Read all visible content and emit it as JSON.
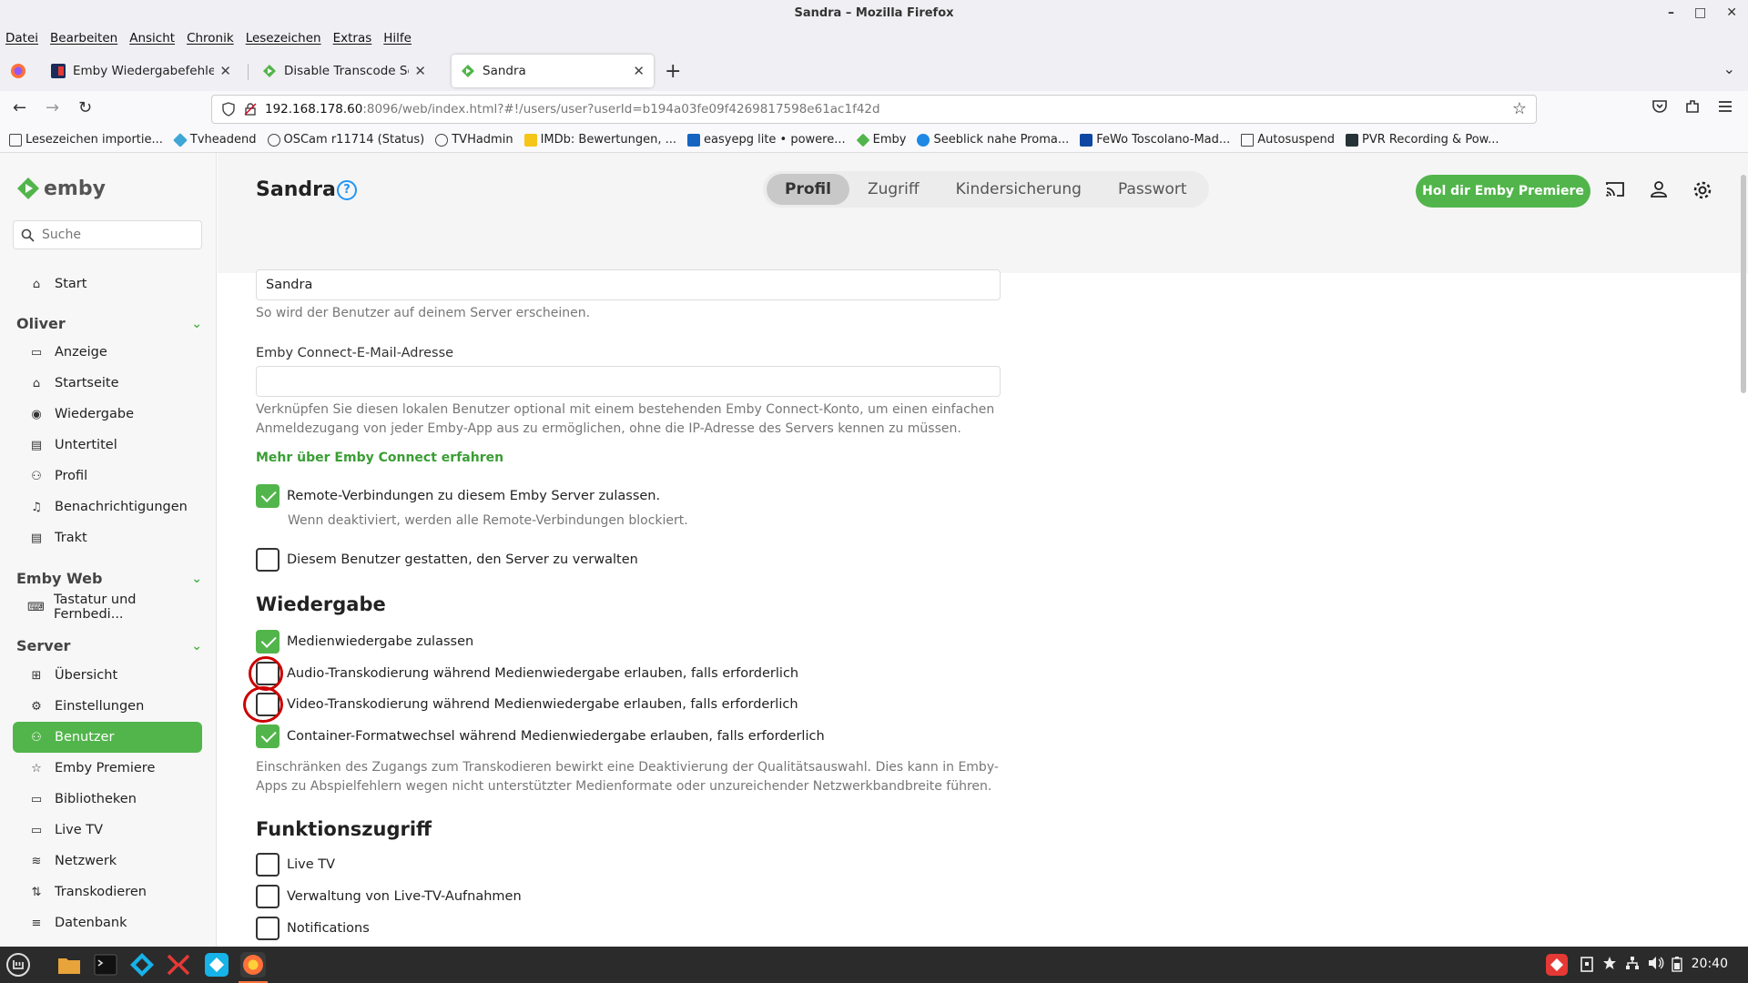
{
  "window": {
    "title": "Sandra – Mozilla Firefox",
    "minimize": "–",
    "maximize": "□",
    "close": "✕"
  },
  "menubar": [
    "Datei",
    "Bearbeiten",
    "Ansicht",
    "Chronik",
    "Lesezeichen",
    "Extras",
    "Hilfe"
  ],
  "tabs": [
    {
      "label": "Emby Wiedergabefehler be",
      "close": "✕"
    },
    {
      "label": "Disable Transcode Setting C",
      "close": "✕"
    },
    {
      "label": "Sandra",
      "close": "✕"
    }
  ],
  "newtab": "+",
  "tab_list": "⌄",
  "nav": {
    "back": "←",
    "forward": "→",
    "reload": "↻",
    "url_host": "192.168.178.60",
    "url_rest": ":8096/web/index.html?#!/users/user?userId=b194a03fe09f4269817598e61ac1f42d",
    "bookmark_star": "☆"
  },
  "bookmarks": [
    "Lesezeichen importie...",
    "Tvheadend",
    "OSCam r11714 (Status)",
    "TVHadmin",
    "IMDb: Bewertungen, ...",
    "easyepg lite • powere...",
    "Emby",
    "Seeblick nahe Proma...",
    "FeWo Toscolano-Mad...",
    "Autosuspend",
    "PVR Recording & Pow..."
  ],
  "emby": {
    "logo_text": "emby",
    "search_placeholder": "Suche",
    "nav": {
      "start": "Start",
      "section_oliver": "Oliver",
      "anzeige": "Anzeige",
      "startseite": "Startseite",
      "wiedergabe": "Wiedergabe",
      "untertitel": "Untertitel",
      "profil": "Profil",
      "benachrichtigungen": "Benachrichtigungen",
      "trakt": "Trakt",
      "section_embyweb": "Emby Web",
      "tastatur": "Tastatur und Fernbedi...",
      "section_server": "Server",
      "uebersicht": "Übersicht",
      "einstellungen": "Einstellungen",
      "benutzer": "Benutzer",
      "emby_premiere": "Emby Premiere",
      "bibliotheken": "Bibliotheken",
      "live_tv": "Live TV",
      "netzwerk": "Netzwerk",
      "transkodieren": "Transkodieren",
      "datenbank": "Datenbank"
    },
    "header": {
      "title": "Sandra",
      "help": "?",
      "tabs": [
        "Profil",
        "Zugriff",
        "Kindersicherung",
        "Passwort"
      ],
      "premiere_button": "Hol dir Emby Premiere"
    },
    "form": {
      "name_value": "Sandra",
      "name_hint": "So wird der Benutzer auf deinem Server erscheinen.",
      "connect_label": "Emby Connect-E-Mail-Adresse",
      "connect_value": "",
      "connect_hint": "Verknüpfen Sie diesen lokalen Benutzer optional mit einem bestehenden Emby Connect-Konto, um einen einfachen Anmeldezugang von jeder Emby-App aus zu ermöglichen, ohne die IP-Adresse des Servers kennen zu müssen.",
      "connect_link": "Mehr über Emby Connect erfahren",
      "remote_label": "Remote-Verbindungen zu diesem Emby Server zulassen.",
      "remote_hint": "Wenn deaktiviert, werden alle Remote-Verbindungen blockiert.",
      "admin_label": "Diesem Benutzer gestatten, den Server zu verwalten",
      "wiedergabe_heading": "Wiedergabe",
      "media_playback": "Medienwiedergabe zulassen",
      "audio_transcode": "Audio-Transkodierung während Medienwiedergabe erlauben, falls erforderlich",
      "video_transcode": "Video-Transkodierung während Medienwiedergabe erlauben, falls erforderlich",
      "container_remux": "Container-Formatwechsel während Medienwiedergabe erlauben, falls erforderlich",
      "transcode_hint": "Einschränken des Zugangs zum Transkodieren bewirkt eine Deaktivierung der Qualitätsauswahl. Dies kann in Emby-Apps zu Abspielfehlern wegen nicht unterstützter Medienformate oder unzureichender Netzwerkbandbreite führen.",
      "feature_heading": "Funktionszugriff",
      "live_tv": "Live TV",
      "live_tv_mgmt": "Verwaltung von Live-TV-Aufnahmen",
      "notifications": "Notifications"
    },
    "checks": {
      "remote": true,
      "admin": false,
      "media_playback": true,
      "audio_transcode": false,
      "video_transcode": false,
      "container_remux": true,
      "live_tv": false,
      "live_tv_mgmt": false,
      "notifications": false
    }
  },
  "taskbar": {
    "clock": "20:40"
  },
  "colors": {
    "emby_green": "#52b54b",
    "annotation_red": "#cc0000"
  }
}
